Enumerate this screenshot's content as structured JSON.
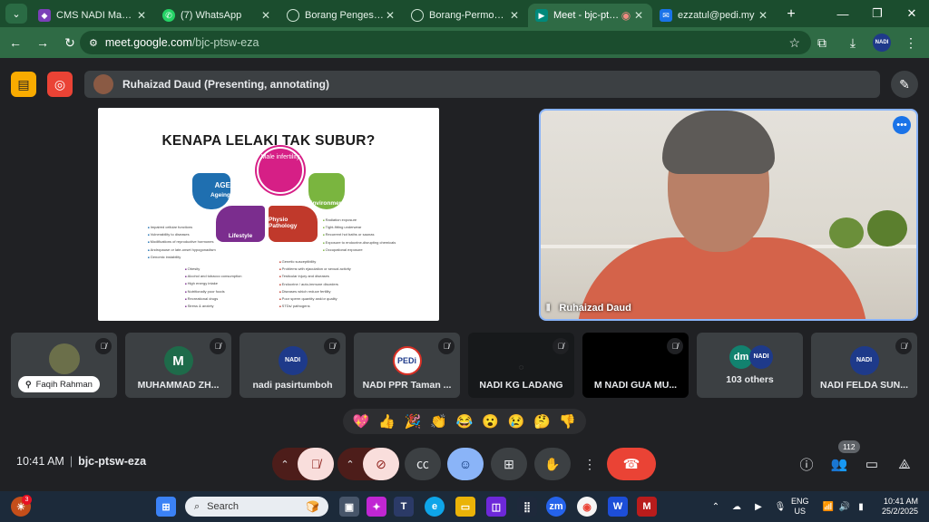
{
  "browser": {
    "tabs": [
      {
        "label": "CMS NADI Manager",
        "fav_color": "#7b3fb8",
        "active": false
      },
      {
        "label": "(7) WhatsApp",
        "fav_color": "#25d366",
        "active": false
      },
      {
        "label": "Borang Pengesahan T",
        "fav_color": "#5f6368",
        "active": false
      },
      {
        "label": "Borang-Permohonan",
        "fav_color": "#5f6368",
        "active": false
      },
      {
        "label": "Meet - bjc-ptsw-",
        "fav_color": "#00897b",
        "active": true
      },
      {
        "label": "ezzatul@pedi.my",
        "fav_color": "#1a73e8",
        "active": false
      }
    ],
    "url_host": "meet.google.com",
    "url_path": "/bjc-ptsw-eza",
    "profile_label": "NADI"
  },
  "meet": {
    "presenting_label": "Ruhaizad Daud (Presenting, annotating)",
    "slide": {
      "title": "KENAPA LELAKI TAK SUBUR?",
      "center_label": "Male infertility",
      "age_label": "AGE",
      "ageing_label": "Ageing",
      "lifestyle_label": "Lifestyle",
      "environment_label": "Environment",
      "physio_label": "Physio Pathology",
      "ageing_items": [
        "Impaired cellular functions",
        "Vulnerability to diseases",
        "Modifications of reproductive hormones",
        "Andropause or late-onset hypogonadism",
        "Genomic instability"
      ],
      "environment_items": [
        "Radiation exposure",
        "Tight-fitting underwear",
        "Recurrent hot baths or saunas",
        "Exposure to endocrine-disrupting chemicals",
        "Occupational exposure"
      ],
      "lifestyle_items": [
        "Obesity",
        "Alcohol and tobacco consumption",
        "High energy intake",
        "Nutritionally poor foods",
        "Recreational drugs",
        "Stress & anxiety"
      ],
      "physio_items": [
        "Genetic susceptibility",
        "Problems with ejaculation or sexual activity",
        "Testicular injury and diseases",
        "Endocrine / auto-immune disorders",
        "Diseases which reduce fertility",
        "Poor sperm quantity and/or quality",
        "STDs/ pathogens"
      ]
    },
    "presenter_name": "Ruhaizad Daud",
    "participants": [
      {
        "name": "Faqih Rahman",
        "type": "photo"
      },
      {
        "name": "MUHAMMAD ZH...",
        "initial": "M",
        "avatar_color": "#1e6b4a",
        "type": "initial"
      },
      {
        "name": "nadi pasirtumboh",
        "type": "nadi"
      },
      {
        "name": "NADI PPR Taman ...",
        "type": "pedi"
      },
      {
        "name": "NADI KG LADANG",
        "type": "dark"
      },
      {
        "name": "M NADI GUA MU...",
        "type": "black"
      },
      {
        "name": "103 others",
        "initial": "dm",
        "avatar_color": "#12826f",
        "type": "others"
      },
      {
        "name": "NADI FELDA SUN...",
        "type": "nadi"
      }
    ],
    "nadi_logo_text": "NADI",
    "pedi_logo_text": "PEDi",
    "reactions": [
      "💖",
      "👍",
      "🎉",
      "👏",
      "😂",
      "😮",
      "😢",
      "🤔",
      "👎"
    ],
    "time": "10:41 AM",
    "meeting_code": "bjc-ptsw-eza",
    "people_count": "112"
  },
  "taskbar": {
    "search_placeholder": "Search",
    "notification_count": "3",
    "lang_top": "ENG",
    "lang_bottom": "US",
    "clock_time": "10:41 AM",
    "clock_date": "25/2/2025"
  }
}
